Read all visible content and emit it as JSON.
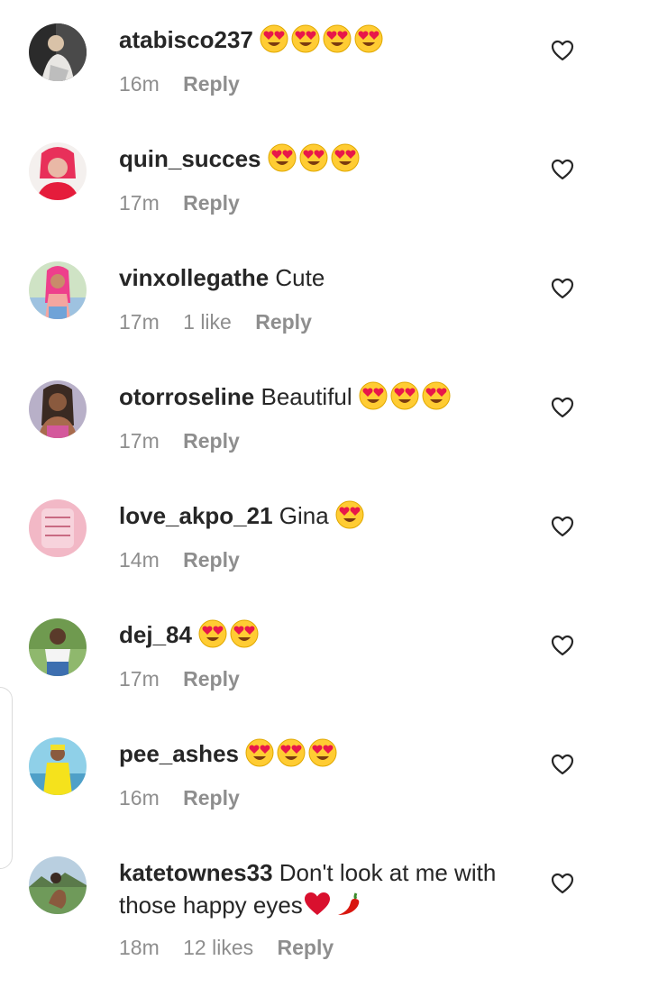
{
  "colors": {
    "text_primary": "#262626",
    "text_secondary": "#8e8e8e",
    "background": "#ffffff"
  },
  "icons": {
    "like": "heart-outline-icon",
    "heart_eyes": "heart-eyes-emoji",
    "red_heart": "red-heart-emoji",
    "chili": "hot-pepper-emoji"
  },
  "comments": [
    {
      "username": "atabisco237",
      "text": "",
      "emoji": "😍😍😍😍",
      "time": "16m",
      "likes": "",
      "reply": "Reply"
    },
    {
      "username": "quin_succes",
      "text": "",
      "emoji": "😍😍😍",
      "time": "17m",
      "likes": "",
      "reply": "Reply"
    },
    {
      "username": "vinxollegathe",
      "text": "Cute",
      "emoji": "",
      "time": "17m",
      "likes": "1 like",
      "reply": "Reply"
    },
    {
      "username": "otorroseline",
      "text": "Beautiful",
      "emoji": "😍😍😍",
      "time": "17m",
      "likes": "",
      "reply": "Reply"
    },
    {
      "username": "love_akpo_21",
      "text": "Gina",
      "emoji": "😍",
      "time": "14m",
      "likes": "",
      "reply": "Reply"
    },
    {
      "username": "dej_84",
      "text": "",
      "emoji": "😍😍",
      "time": "17m",
      "likes": "",
      "reply": "Reply"
    },
    {
      "username": "pee_ashes",
      "text": "",
      "emoji": "😍😍😍",
      "time": "16m",
      "likes": "",
      "reply": "Reply"
    },
    {
      "username": "katetownes33",
      "text": "Don't look at me with those happy eyes",
      "emoji": "❤️🌶️",
      "time": "18m",
      "likes": "12 likes",
      "reply": "Reply"
    }
  ]
}
